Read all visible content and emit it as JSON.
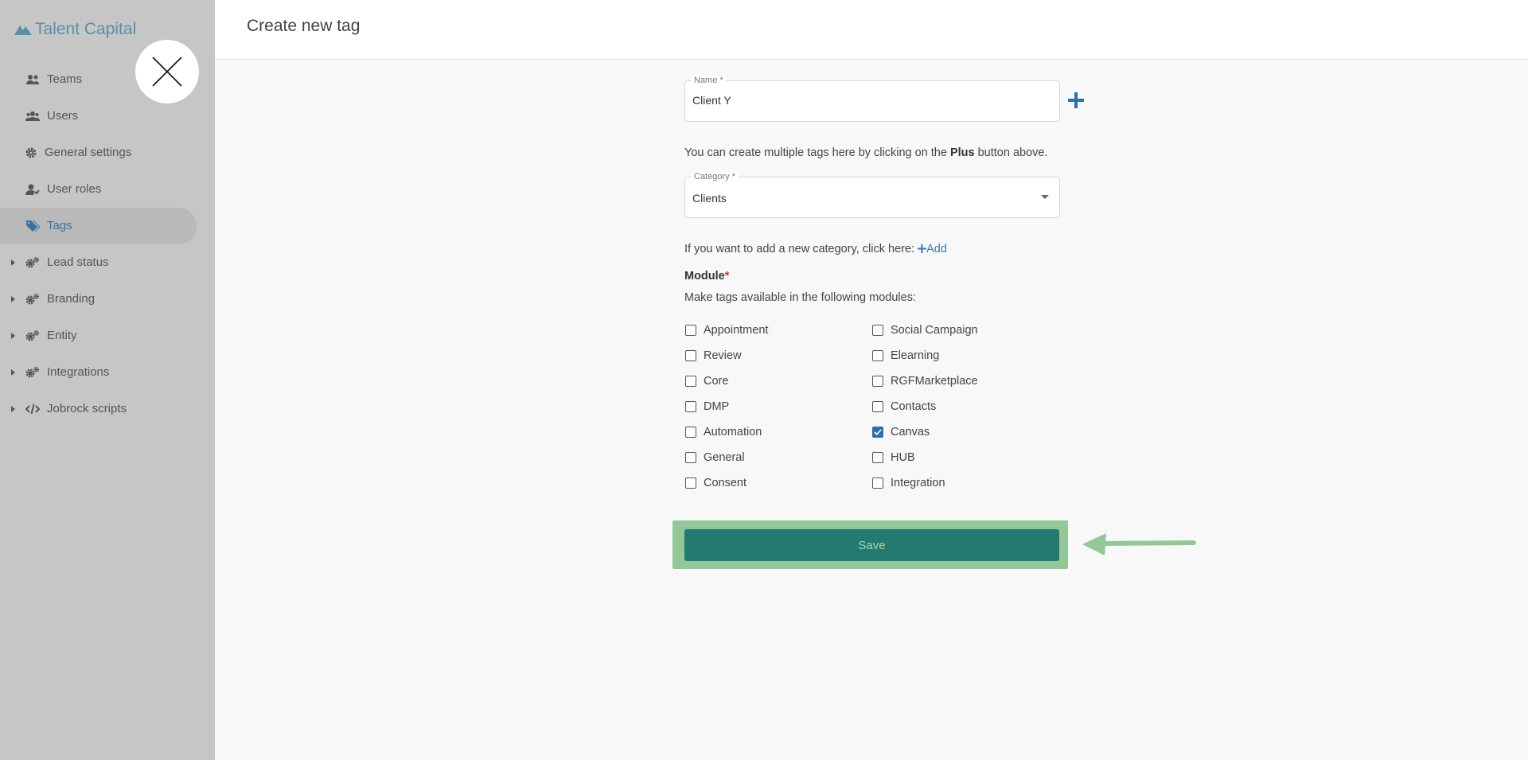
{
  "app": {
    "brand": "Talent Capital"
  },
  "sidebar": {
    "items": [
      {
        "label": "Teams",
        "icon": "users-icon"
      },
      {
        "label": "Users",
        "icon": "users-group-icon"
      },
      {
        "label": "General settings",
        "icon": "gear-icon"
      },
      {
        "label": "User roles",
        "icon": "user-role-icon"
      },
      {
        "label": "Tags",
        "icon": "tags-icon",
        "active": true
      },
      {
        "label": "Lead status",
        "icon": "gears-icon",
        "expandable": true
      },
      {
        "label": "Branding",
        "icon": "gears-icon",
        "expandable": true
      },
      {
        "label": "Entity",
        "icon": "gears-icon",
        "expandable": true
      },
      {
        "label": "Integrations",
        "icon": "gears-icon",
        "expandable": true
      },
      {
        "label": "Jobrock scripts",
        "icon": "code-icon",
        "expandable": true
      }
    ]
  },
  "header": {
    "title": "Create new tag"
  },
  "form": {
    "name_label": "Name *",
    "name_value": "Client Y",
    "helper_pre": "You can create multiple tags here by clicking on the ",
    "helper_bold": "Plus",
    "helper_post": " button above.",
    "category_label": "Category *",
    "category_value": "Clients",
    "category_hint": "If you want to add a new category, click here:",
    "add_label": "Add",
    "module_title": "Module",
    "module_required": "*",
    "module_description": "Make tags available in the following modules:",
    "modules_left": [
      {
        "label": "Appointment",
        "checked": false
      },
      {
        "label": "Review",
        "checked": false
      },
      {
        "label": "Core",
        "checked": false
      },
      {
        "label": "DMP",
        "checked": false
      },
      {
        "label": "Automation",
        "checked": false
      },
      {
        "label": "General",
        "checked": false
      },
      {
        "label": "Consent",
        "checked": false
      }
    ],
    "modules_right": [
      {
        "label": "Social Campaign",
        "checked": false
      },
      {
        "label": "Elearning",
        "checked": false
      },
      {
        "label": "RGFMarketplace",
        "checked": false
      },
      {
        "label": "Contacts",
        "checked": false
      },
      {
        "label": "Canvas",
        "checked": true
      },
      {
        "label": "HUB",
        "checked": false
      },
      {
        "label": "Integration",
        "checked": false
      }
    ],
    "save_label": "Save"
  },
  "colors": {
    "accent": "#2c6fb0",
    "save_button": "#247a70",
    "highlight": "#94c798",
    "sidebar_bg": "#c6c6c6"
  }
}
